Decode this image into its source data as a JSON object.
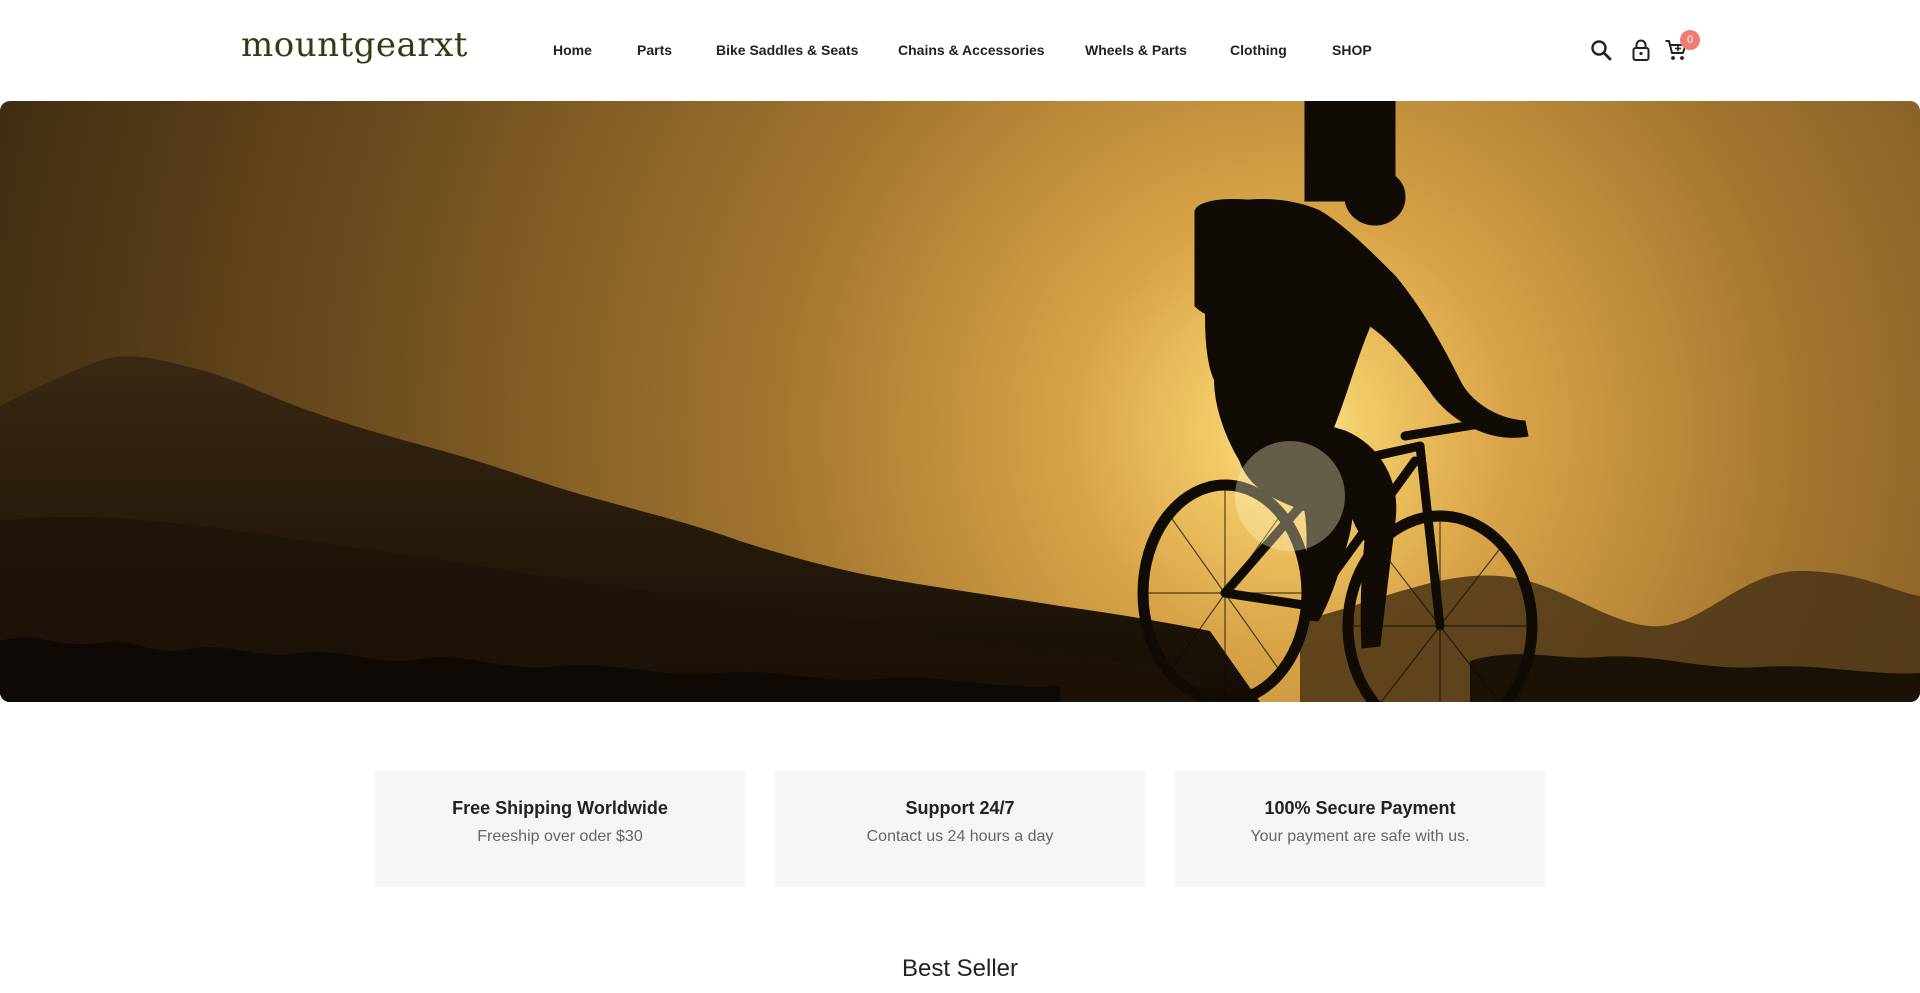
{
  "brand": {
    "logo_text": "mountgearxt",
    "logo_color": "#2f3d12",
    "accent_color": "#f07a74"
  },
  "nav": {
    "items": [
      {
        "label": "Home"
      },
      {
        "label": "Parts"
      },
      {
        "label": "Bike Saddles & Seats"
      },
      {
        "label": "Chains & Accessories"
      },
      {
        "label": "Wheels & Parts"
      },
      {
        "label": "Clothing"
      },
      {
        "label": "SHOP"
      }
    ]
  },
  "header_icons": {
    "search": "search-icon",
    "account": "lock-icon",
    "cart": "cart-icon",
    "cart_count": "0"
  },
  "hero": {
    "image": "silhouette of a mountain biker riding at sunset over rocky hills"
  },
  "features": [
    {
      "title": "Free Shipping Worldwide",
      "subtitle": "Freeship over oder $30"
    },
    {
      "title": "Support 24/7",
      "subtitle": "Contact us 24 hours a day"
    },
    {
      "title": "100% Secure Payment",
      "subtitle": "Your payment are safe with us."
    }
  ],
  "sections": {
    "best_seller_title": "Best Seller"
  }
}
